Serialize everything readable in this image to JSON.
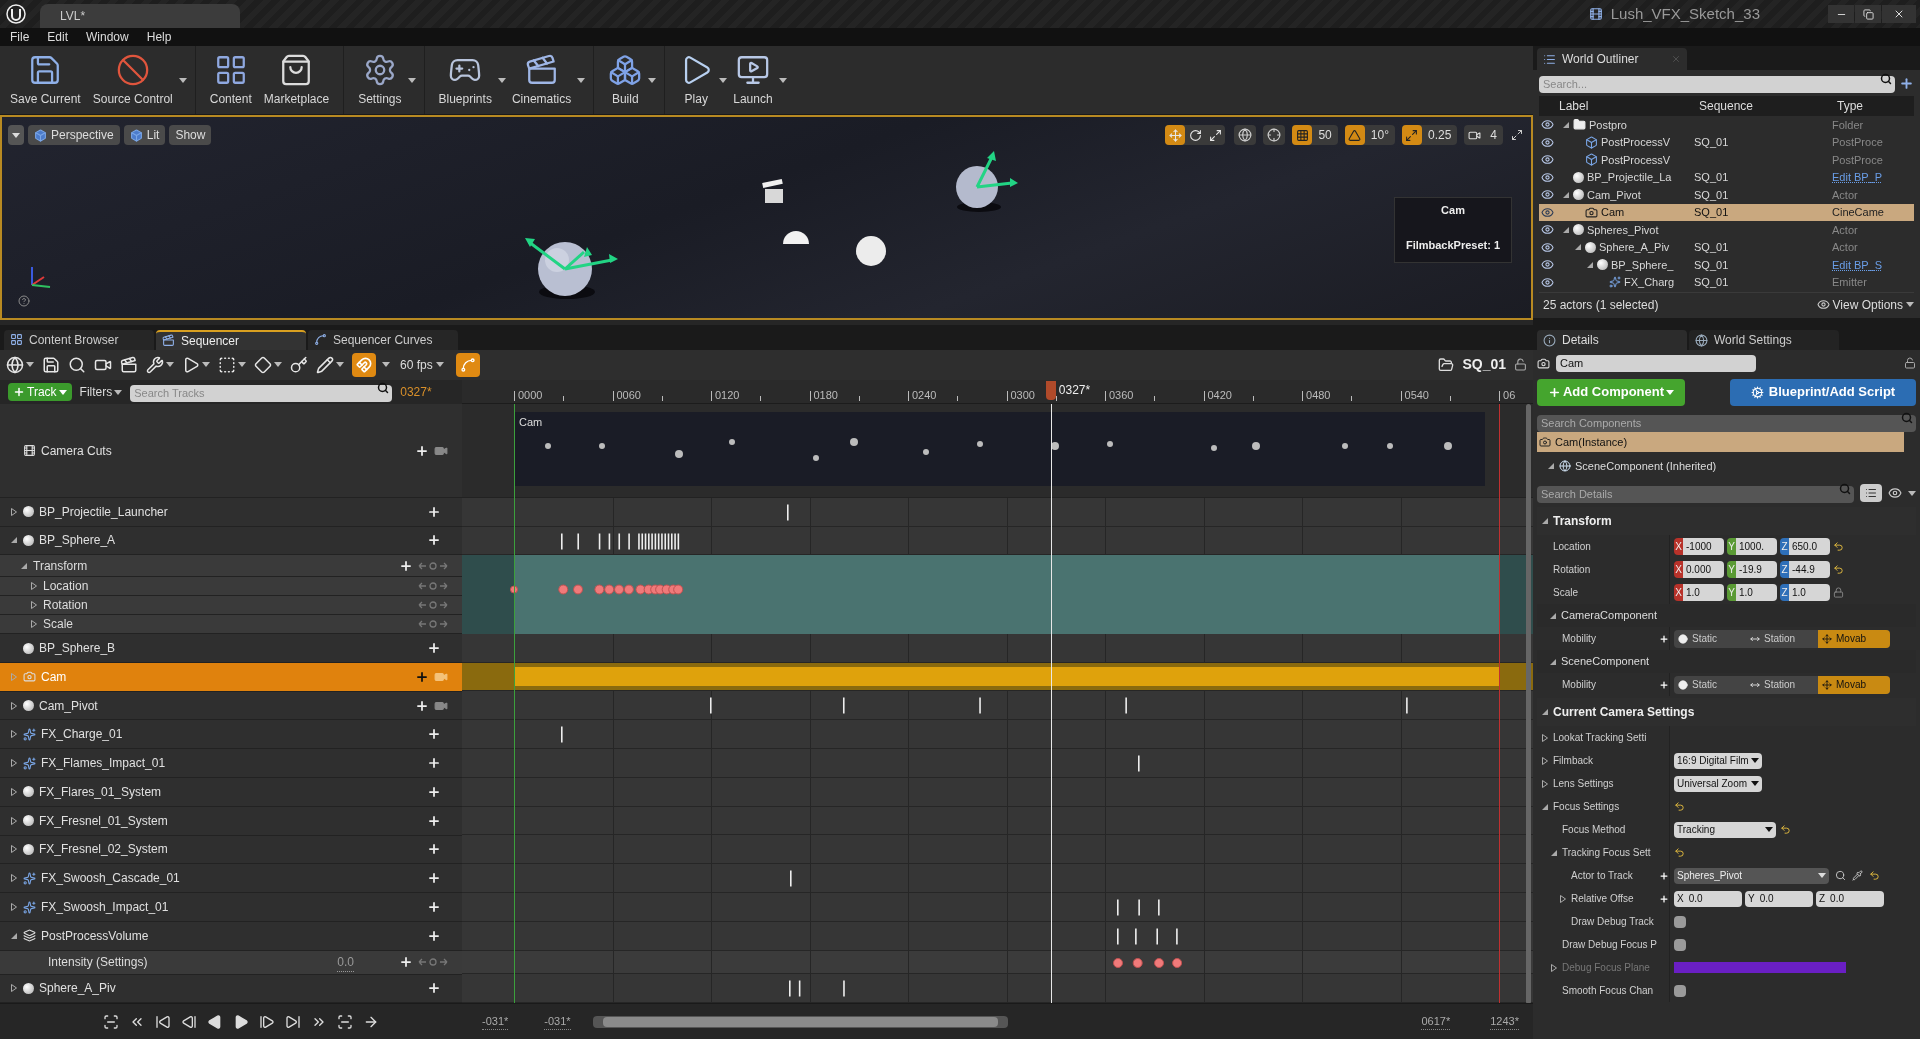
{
  "app": {
    "tab_title": "LVL*",
    "project": "Lush_VFX_Sketch_33"
  },
  "menu": [
    "File",
    "Edit",
    "Window",
    "Help"
  ],
  "toolbar": [
    [
      {
        "label": "Save Current",
        "kind": "save",
        "dropdown": false
      },
      {
        "label": "Source Control",
        "kind": "source",
        "dropdown": true
      }
    ],
    [
      {
        "label": "Content",
        "kind": "content",
        "dropdown": false
      },
      {
        "label": "Marketplace",
        "kind": "market",
        "dropdown": false
      }
    ],
    [
      {
        "label": "Settings",
        "kind": "settings",
        "dropdown": true
      }
    ],
    [
      {
        "label": "Blueprints",
        "kind": "blueprints",
        "dropdown": true
      },
      {
        "label": "Cinematics",
        "kind": "cinematics",
        "dropdown": true
      }
    ],
    [
      {
        "label": "Build",
        "kind": "build",
        "dropdown": true
      }
    ],
    [
      {
        "label": "Play",
        "kind": "play",
        "dropdown": true
      },
      {
        "label": "Launch",
        "kind": "launch",
        "dropdown": true
      }
    ]
  ],
  "viewport": {
    "buttons": [
      {
        "label": "Perspective",
        "kind": "perspective"
      },
      {
        "label": "Lit",
        "kind": "lit"
      },
      {
        "label": "Show",
        "kind": "show"
      }
    ],
    "transform_modes": [
      {
        "kind": "move",
        "selected": true
      },
      {
        "kind": "rotate",
        "selected": false
      },
      {
        "kind": "scale",
        "selected": false
      }
    ],
    "snaps": [
      {
        "kind": "grid",
        "on": true,
        "value": "50"
      },
      {
        "kind": "angle",
        "on": true,
        "value": "10°"
      },
      {
        "kind": "scale",
        "on": true,
        "value": "0.25"
      },
      {
        "kind": "speed",
        "on": false,
        "value": "4"
      }
    ],
    "preview": {
      "title": "Cam",
      "caption": "FilmbackPreset: 1"
    }
  },
  "sequencer": {
    "tabs": [
      {
        "label": "Content Browser",
        "kind": "content",
        "selected": false
      },
      {
        "label": "Sequencer",
        "kind": "sequencer",
        "selected": true
      },
      {
        "label": "Sequencer Curves",
        "kind": "curves",
        "selected": false
      }
    ],
    "toggles": [
      {
        "kind": "magnet",
        "on": true
      },
      {
        "kind": "curve",
        "on": true
      }
    ],
    "fps": "60 fps",
    "sequence": "SQ_01",
    "track_button": "Track",
    "filters": "Filters",
    "search": {
      "placeholder": "Search Tracks"
    },
    "current_frame": "0327*",
    "ruler": [
      "0000",
      "0060",
      "0120",
      "0180",
      "0240",
      "0300",
      "0360",
      "0420",
      "0480",
      "0540",
      "06"
    ],
    "playhead": "0327*",
    "cut_label": "Cam",
    "tracks": [
      {
        "label": "Camera Cuts",
        "kind": "camera_cuts",
        "camera_lock": true,
        "selected": false
      },
      {
        "label": "BP_Projectile_Launcher",
        "kind": "actor",
        "expanded": false,
        "selected": false
      },
      {
        "label": "BP_Sphere_A",
        "kind": "actor",
        "expanded": true,
        "selected": false,
        "children": [
          {
            "label": "Transform",
            "kind": "group",
            "expanded": true,
            "children": [
              {
                "label": "Location",
                "kind": "channel",
                "expanded": false
              },
              {
                "label": "Rotation",
                "kind": "channel",
                "expanded": false
              },
              {
                "label": "Scale",
                "kind": "channel",
                "expanded": false
              }
            ]
          }
        ]
      },
      {
        "label": "BP_Sphere_B",
        "kind": "actor",
        "selected": false
      },
      {
        "label": "Cam",
        "kind": "camera",
        "expanded": false,
        "camera_lock": true,
        "selected": true
      },
      {
        "label": "Cam_Pivot",
        "kind": "actor",
        "expanded": false,
        "camera_lock": true,
        "selected": false
      },
      {
        "label": "FX_Charge_01",
        "kind": "fx",
        "expanded": false,
        "selected": false
      },
      {
        "label": "FX_Flames_Impact_01",
        "kind": "fx",
        "expanded": false,
        "selected": false
      },
      {
        "label": "FX_Flares_01_System",
        "kind": "actor",
        "expanded": false,
        "selected": false
      },
      {
        "label": "FX_Fresnel_01_System",
        "kind": "actor",
        "expanded": false,
        "selected": false
      },
      {
        "label": "FX_Fresnel_02_System",
        "kind": "actor",
        "expanded": false,
        "selected": false
      },
      {
        "label": "FX_Swoosh_Cascade_01",
        "kind": "fx",
        "expanded": false,
        "selected": false
      },
      {
        "label": "FX_Swoosh_Impact_01",
        "kind": "fx",
        "expanded": false,
        "selected": false
      },
      {
        "label": "PostProcessVolume",
        "kind": "postprocess",
        "expanded": true,
        "selected": false,
        "children": [
          {
            "label": "Intensity (Settings)",
            "kind": "property",
            "value": "0.0"
          }
        ]
      },
      {
        "label": "Sphere_A_Piv",
        "kind": "actor",
        "expanded": false,
        "selected": false
      }
    ],
    "range": [
      "-031*",
      "-031*",
      "0617*",
      "1243*"
    ]
  },
  "outliner": {
    "title": "World Outliner",
    "search": {
      "placeholder": "Search..."
    },
    "columns": [
      "Label",
      "Sequence",
      "Type"
    ],
    "rows": [
      {
        "label": "Postpro",
        "kind": "folder",
        "type": "Folder",
        "link": false,
        "expanded": true,
        "selected": false,
        "children": [
          {
            "label": "PostProcessV",
            "kind": "volume",
            "sequence": "SQ_01",
            "type": "PostProce",
            "link": false,
            "selected": false
          },
          {
            "label": "PostProcessV",
            "kind": "volume",
            "type": "PostProce",
            "link": false,
            "selected": false
          }
        ]
      },
      {
        "label": "BP_Projectile_La",
        "kind": "actor",
        "sequence": "SQ_01",
        "type": "Edit BP_P",
        "link": true,
        "selected": false
      },
      {
        "label": "Cam_Pivot",
        "kind": "actor",
        "sequence": "SQ_01",
        "type": "Actor",
        "link": false,
        "expanded": true,
        "selected": false,
        "children": [
          {
            "label": "Cam",
            "kind": "camera",
            "sequence": "SQ_01",
            "type": "CineCame",
            "link": false,
            "selected": true
          }
        ]
      },
      {
        "label": "Spheres_Pivot",
        "kind": "actor",
        "type": "Actor",
        "link": false,
        "expanded": true,
        "selected": false,
        "children": [
          {
            "label": "Sphere_A_Piv",
            "kind": "actor",
            "sequence": "SQ_01",
            "type": "Actor",
            "link": false,
            "expanded": true,
            "selected": false,
            "children": [
              {
                "label": "BP_Sphere_",
                "kind": "actor",
                "sequence": "SQ_01",
                "type": "Edit BP_S",
                "link": true,
                "expanded": true,
                "selected": false,
                "children": [
                  {
                    "label": "FX_Charg",
                    "kind": "emitter",
                    "sequence": "SQ_01",
                    "type": "Emitter",
                    "link": false,
                    "selected": false
                  }
                ]
              }
            ]
          }
        ]
      }
    ],
    "footer": "25 actors (1 selected)",
    "view_options": "View Options"
  },
  "details": {
    "tabs": [
      {
        "label": "Details",
        "kind": "details",
        "selected": true
      },
      {
        "label": "World Settings",
        "kind": "world",
        "selected": false
      }
    ],
    "name": "Cam",
    "add_component": "Add Component",
    "blueprint": "Blueprint/Add Script",
    "component_search": {
      "placeholder": "Search Components"
    },
    "components": [
      {
        "label": "Cam(Instance)",
        "kind": "camera",
        "selected": true
      },
      {
        "label": "SceneComponent (Inherited)",
        "kind": "scene",
        "expanded": true,
        "selected": false
      }
    ],
    "detail_search": {
      "placeholder": "Search Details"
    },
    "properties": [
      {
        "label": "Transform",
        "kind": "section",
        "expanded": true,
        "children": [
          {
            "label": "Location",
            "kind": "vector",
            "axes": [
              "X",
              "Y",
              "Z"
            ],
            "values": [
              "-1000",
              "1000.",
              "650.0"
            ],
            "reset": true
          },
          {
            "label": "Rotation",
            "kind": "vector",
            "axes": [
              "X",
              "Y",
              "Z"
            ],
            "values": [
              "0.000",
              "-19.9",
              "-44.9"
            ],
            "reset": true
          },
          {
            "label": "Scale",
            "kind": "vector",
            "axes": [
              "X",
              "Y",
              "Z"
            ],
            "values": [
              "1.0",
              "1.0",
              "1.0"
            ],
            "lock": true
          },
          {
            "label": "CameraComponent",
            "kind": "category",
            "expanded": true,
            "children": [
              {
                "label": "Mobility",
                "kind": "mobility",
                "options": [
                  {
                    "label": "Static",
                    "kind": "static",
                    "selected": false
                  },
                  {
                    "label": "Station",
                    "kind": "stationary",
                    "selected": false
                  },
                  {
                    "label": "Movab",
                    "kind": "movable",
                    "selected": true
                  }
                ]
              }
            ]
          },
          {
            "label": "SceneComponent",
            "kind": "category",
            "expanded": true,
            "children": [
              {
                "label": "Mobility",
                "kind": "mobility",
                "options": [
                  {
                    "label": "Static",
                    "kind": "static",
                    "selected": false
                  },
                  {
                    "label": "Station",
                    "kind": "stationary",
                    "selected": false
                  },
                  {
                    "label": "Movab",
                    "kind": "movable",
                    "selected": true
                  }
                ]
              }
            ]
          }
        ]
      },
      {
        "label": "Current Camera Settings",
        "kind": "section",
        "expanded": true,
        "children": [
          {
            "label": "Lookat Tracking Setti",
            "kind": "group",
            "expanded": false
          },
          {
            "label": "Filmback",
            "kind": "dropdown",
            "expanded": false,
            "value": "16:9 Digital Film"
          },
          {
            "label": "Lens Settings",
            "kind": "dropdown",
            "expanded": false,
            "value": "Universal Zoom"
          },
          {
            "label": "Focus Settings",
            "kind": "group",
            "expanded": true,
            "reset": true,
            "children": [
              {
                "label": "Focus Method",
                "kind": "dropdown",
                "value": "Tracking",
                "reset": true
              },
              {
                "label": "Tracking Focus Sett",
                "kind": "group",
                "expanded": true,
                "reset": true,
                "children": [
                  {
                    "label": "Actor to Track",
                    "kind": "picker",
                    "value": "Spheres_Pivot",
                    "reset": true
                  },
                  {
                    "label": "Relative Offse",
                    "kind": "offset",
                    "expanded": false,
                    "axes": [
                      "X",
                      "Y",
                      "Z"
                    ],
                    "values": [
                      "0.0",
                      "0.0",
                      "0.0"
                    ]
                  },
                  {
                    "label": "Draw Debug Track",
                    "kind": "checkbox",
                    "checked": false
                  }
                ]
              },
              {
                "label": "Draw Debug Focus P",
                "kind": "checkbox",
                "checked": false
              },
              {
                "label": "Debug Focus Plane",
                "kind": "color",
                "expanded": false,
                "disabled": true,
                "color": "#6a1fc4"
              },
              {
                "label": "Smooth Focus Chan",
                "kind": "checkbox",
                "checked": false
              }
            ]
          }
        ]
      }
    ]
  }
}
